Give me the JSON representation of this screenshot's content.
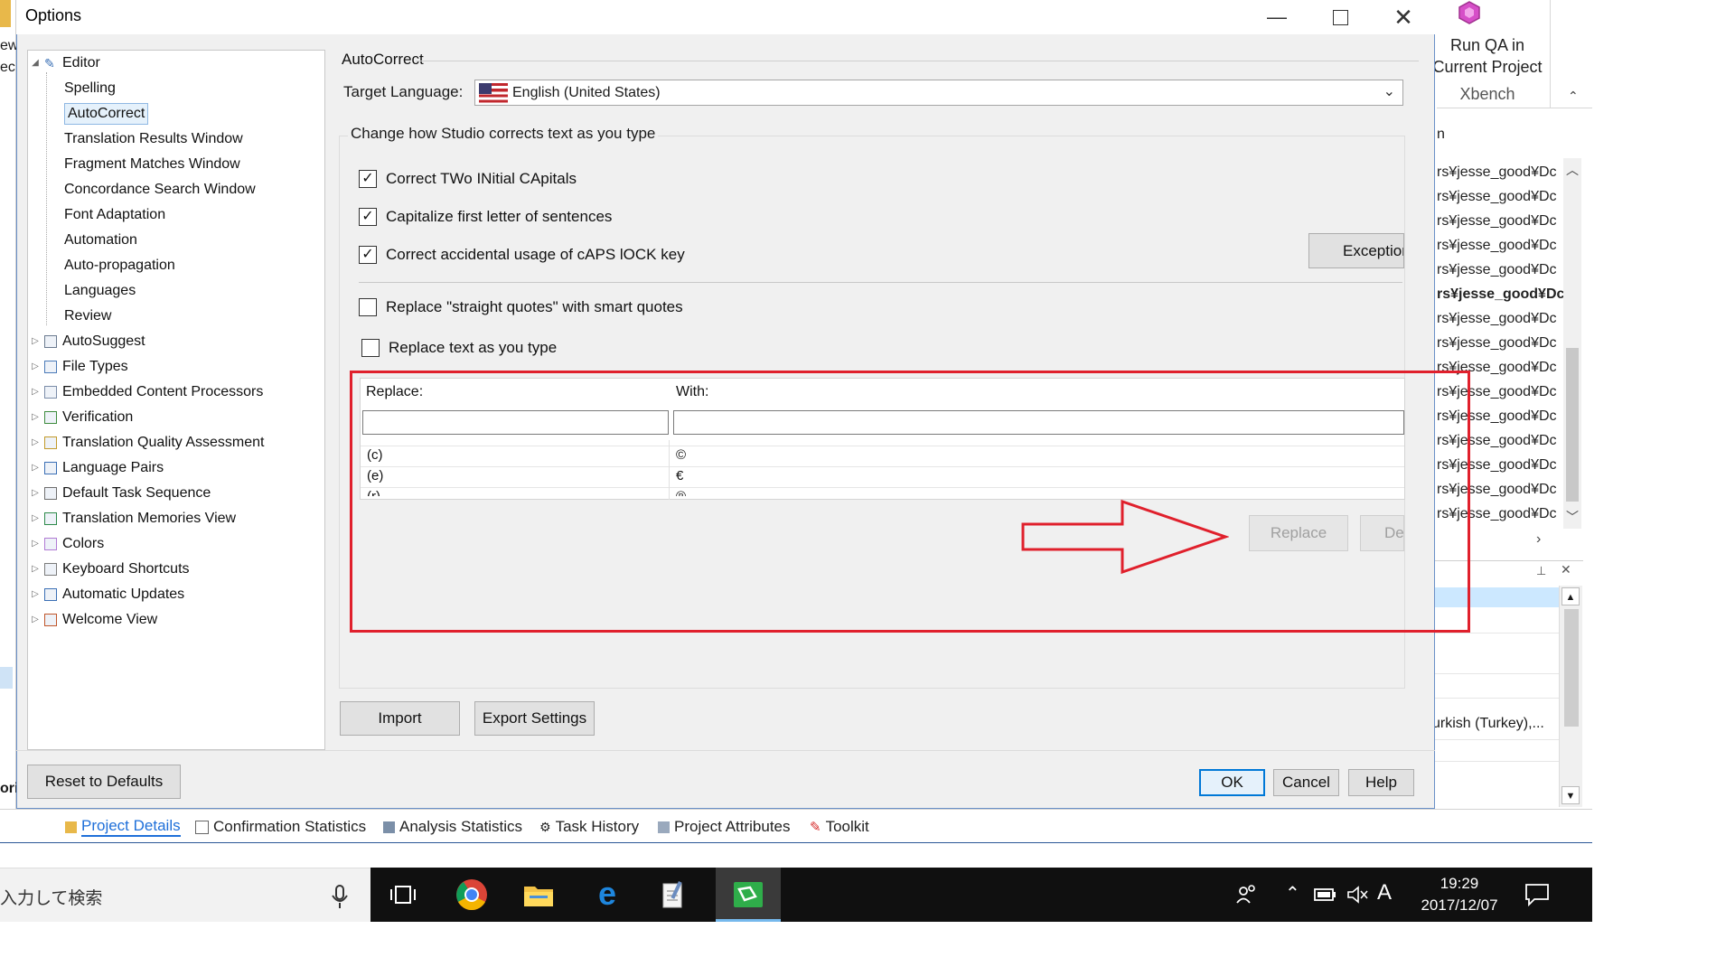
{
  "background": {
    "ribbon": {
      "line1": "Run QA in",
      "line2": "Current Project",
      "line3": "Xbench"
    },
    "list_header": "n",
    "list_rows": [
      "rs¥jesse_good¥Dc",
      "rs¥jesse_good¥Dc",
      "rs¥jesse_good¥Dc",
      "rs¥jesse_good¥Dc",
      "rs¥jesse_good¥Dc",
      "rs¥jesse_good¥Dc",
      "rs¥jesse_good¥Dc",
      "rs¥jesse_good¥Dc",
      "rs¥jesse_good¥Dc",
      "rs¥jesse_good¥Dc",
      "rs¥jesse_good¥Dc",
      "rs¥jesse_good¥Dc",
      "rs¥jesse_good¥Dc",
      "rs¥jesse_good¥Dc",
      "rs¥jesse_good¥Dc"
    ],
    "panel2_text": "urkish (Turkey),...",
    "bottom_tabs": [
      "Project Details",
      "Confirmation Statistics",
      "Analysis Statistics",
      "Task History",
      "Project Attributes",
      "Toolkit"
    ],
    "left_fragments": {
      "a": "ew",
      "b": "ec",
      "c": "ori"
    }
  },
  "taskbar": {
    "search_placeholder": "入力して検索",
    "time": "19:29",
    "date": "2017/12/07",
    "ime": "A"
  },
  "dialog": {
    "title": "Options",
    "tree": [
      {
        "label": "Editor",
        "expanded": true,
        "icon": "pencil-icon"
      },
      {
        "label": "Spelling",
        "child": true
      },
      {
        "label": "AutoCorrect",
        "child": true,
        "selected": true
      },
      {
        "label": "Translation Results Window",
        "child": true
      },
      {
        "label": "Fragment Matches Window",
        "child": true
      },
      {
        "label": "Concordance Search Window",
        "child": true
      },
      {
        "label": "Font Adaptation",
        "child": true
      },
      {
        "label": "Automation",
        "child": true
      },
      {
        "label": "Auto-propagation",
        "child": true
      },
      {
        "label": "Languages",
        "child": true
      },
      {
        "label": "Review",
        "child": true
      },
      {
        "label": "AutoSuggest",
        "icon": "autosuggest-icon"
      },
      {
        "label": "File Types",
        "icon": "file-types-icon"
      },
      {
        "label": "Embedded Content Processors",
        "icon": "embedded-content-icon"
      },
      {
        "label": "Verification",
        "icon": "verification-icon"
      },
      {
        "label": "Translation Quality Assessment",
        "icon": "tqa-icon"
      },
      {
        "label": "Language Pairs",
        "icon": "language-pairs-icon"
      },
      {
        "label": "Default Task Sequence",
        "icon": "task-sequence-icon"
      },
      {
        "label": "Translation Memories View",
        "icon": "tm-view-icon"
      },
      {
        "label": "Colors",
        "icon": "colors-icon"
      },
      {
        "label": "Keyboard Shortcuts",
        "icon": "keyboard-icon"
      },
      {
        "label": "Automatic Updates",
        "icon": "updates-icon"
      },
      {
        "label": "Welcome View",
        "icon": "home-icon"
      }
    ],
    "section_title": "AutoCorrect",
    "target_language_label": "Target Language:",
    "target_language_value": "English (United States)",
    "group_title": "Change how Studio corrects text as you type",
    "options": {
      "two_initials": "Correct TWo INitial CApitals",
      "capitalize_first": "Capitalize first letter of sentences",
      "caps_lock": "Correct accidental usage of cAPS lOCK key",
      "smart_quotes": "Replace \"straight quotes\" with smart quotes",
      "replace_text": "Replace text as you type"
    },
    "exceptions_button": "Exceptions...",
    "replace_label": "Replace:",
    "with_label": "With:",
    "replace_input": "",
    "with_input": "",
    "replacements": [
      {
        "replace": "(c)",
        "with": "©"
      },
      {
        "replace": "(e)",
        "with": "€"
      },
      {
        "replace": "(r)",
        "with": "®"
      }
    ],
    "replace_button": "Replace",
    "delete_button": "Delete",
    "import_button": "Import",
    "export_button": "Export Settings",
    "reset_button": "Reset to Defaults",
    "ok_button": "OK",
    "cancel_button": "Cancel",
    "help_button": "Help"
  },
  "annotation_color": "#e0202c"
}
